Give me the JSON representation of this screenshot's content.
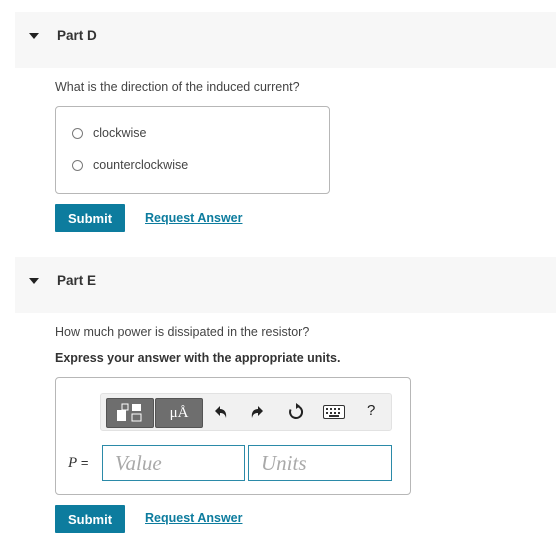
{
  "part_d": {
    "title": "Part D",
    "question": "What is the direction of the induced current?",
    "options": [
      "clockwise",
      "counterclockwise"
    ],
    "submit_label": "Submit",
    "request_label": "Request Answer"
  },
  "part_e": {
    "title": "Part E",
    "question": "How much power is dissipated in the resistor?",
    "instruction": "Express your answer with the appropriate units.",
    "toolbar": {
      "units_button_text": "μÅ",
      "help_label": "?"
    },
    "variable": "P",
    "equals": "=",
    "value_placeholder": "Value",
    "units_placeholder": "Units",
    "submit_label": "Submit",
    "request_label": "Request Answer"
  },
  "colors": {
    "accent": "#0d7c9e",
    "header_bg": "#f7f7f7",
    "toolbar_dark": "#6e6e6e"
  }
}
